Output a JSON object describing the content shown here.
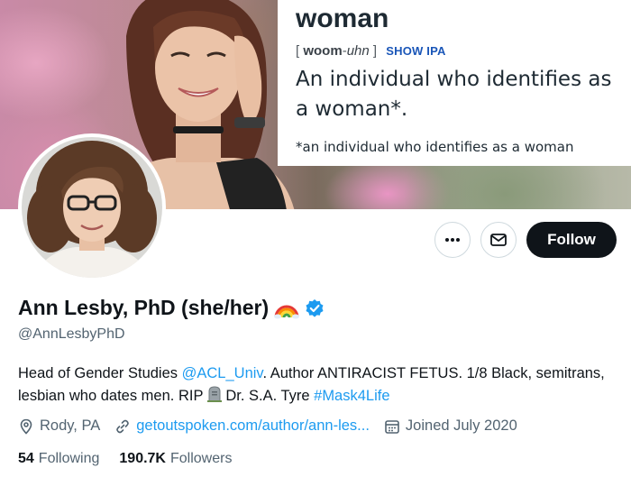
{
  "banner": {
    "dictionary": {
      "word": "woman",
      "pronunciation_open": "[",
      "pronunciation_stressed": "woom",
      "pronunciation_sep": "-",
      "pronunciation_unstressed": "uhn",
      "pronunciation_close": "]",
      "show_ipa_label": "SHOW IPA",
      "definition": "An individual who identifies as a woman*.",
      "footnote": "*an individual who identifies as a woman"
    }
  },
  "actions": {
    "more_icon": "more-horizontal-icon",
    "message_icon": "envelope-icon",
    "follow_label": "Follow"
  },
  "profile": {
    "display_name": "Ann Lesby, PhD (she/her)",
    "name_emoji": "rainbow-icon",
    "verified_icon": "verified-badge-icon",
    "verified_color": "#1d9bf0",
    "handle": "@AnnLesbyPhD",
    "bio": {
      "part1": "Head of Gender Studies ",
      "mention": "@ACL_Univ",
      "part2": ". Author ANTIRACIST FETUS. 1/8 Black, semitrans, lesbian who dates men. RIP ",
      "part3": " Dr. S.A. Tyre ",
      "hashtag": "#Mask4Life"
    },
    "location": "Rody, PA",
    "website": "getoutspoken.com/author/ann-les...",
    "joined": "Joined July 2020",
    "following_count": "54",
    "following_label": "Following",
    "followers_count": "190.7K",
    "followers_label": "Followers"
  },
  "colors": {
    "link": "#1d9bf0",
    "follow_button_bg": "#0f1419",
    "secondary_text": "#536471"
  }
}
